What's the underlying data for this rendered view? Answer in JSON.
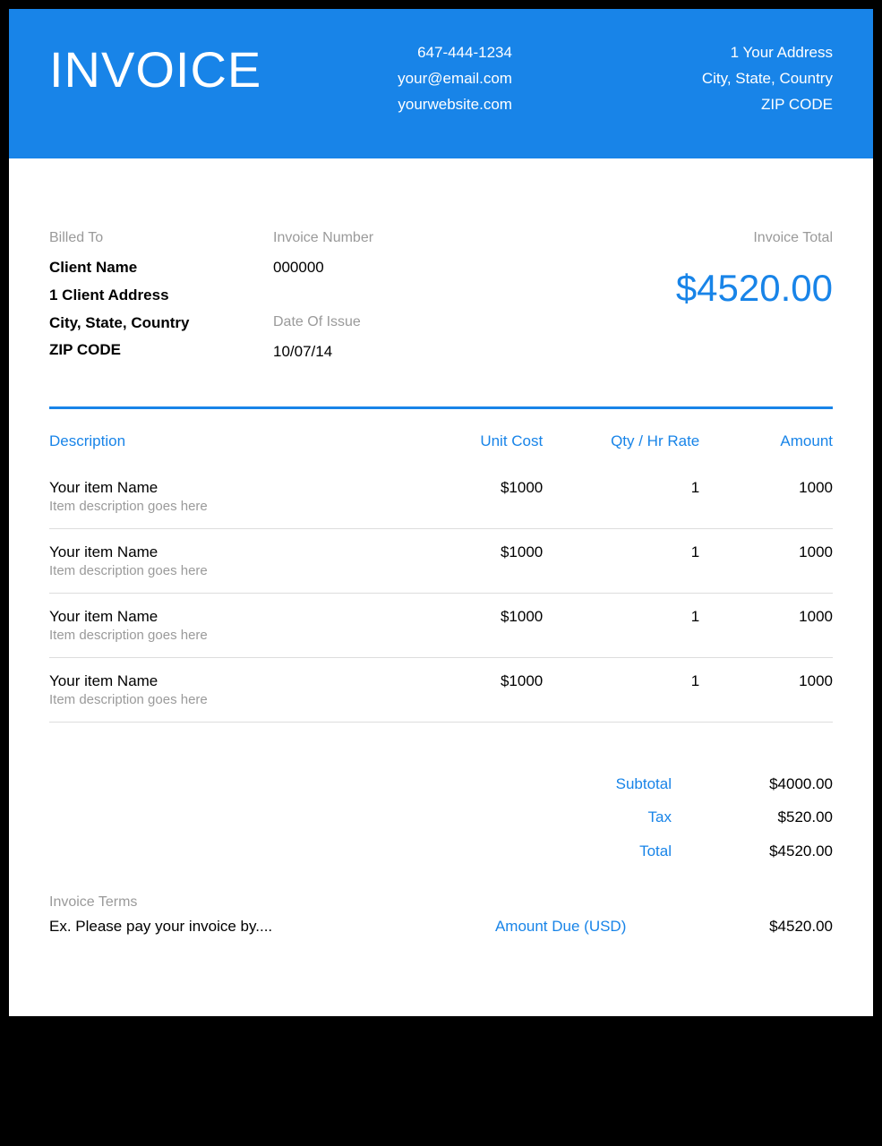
{
  "header": {
    "title": "INVOICE",
    "phone": "647-444-1234",
    "email": "your@email.com",
    "website": "yourwebsite.com",
    "addr1": "1 Your Address",
    "addr2": "City, State, Country",
    "addr3": "ZIP CODE"
  },
  "meta": {
    "billed_label": "Billed To",
    "client_name": "Client Name",
    "client_addr1": "1 Client Address",
    "client_addr2": "City, State, Country",
    "client_addr3": "ZIP CODE",
    "invnum_label": "Invoice Number",
    "invnum": "000000",
    "date_label": "Date Of Issue",
    "date": "10/07/14",
    "total_label": "Invoice Total",
    "total": "$4520.00"
  },
  "columns": {
    "description": "Description",
    "unit_cost": "Unit Cost",
    "qty": "Qty / Hr Rate",
    "amount": "Amount"
  },
  "items": [
    {
      "name": "Your item Name",
      "desc": "Item description goes here",
      "cost": "$1000",
      "qty": "1",
      "amount": "1000"
    },
    {
      "name": "Your item Name",
      "desc": "Item description goes here",
      "cost": "$1000",
      "qty": "1",
      "amount": "1000"
    },
    {
      "name": "Your item Name",
      "desc": "Item description goes here",
      "cost": "$1000",
      "qty": "1",
      "amount": "1000"
    },
    {
      "name": "Your item Name",
      "desc": "Item description goes here",
      "cost": "$1000",
      "qty": "1",
      "amount": "1000"
    }
  ],
  "totals": {
    "subtotal_label": "Subtotal",
    "subtotal": "$4000.00",
    "tax_label": "Tax",
    "tax": "$520.00",
    "total_label": "Total",
    "total": "$4520.00"
  },
  "terms": {
    "label": "Invoice Terms",
    "text": "Ex. Please pay your invoice by....",
    "due_label": "Amount Due (USD)",
    "due_value": "$4520.00"
  }
}
